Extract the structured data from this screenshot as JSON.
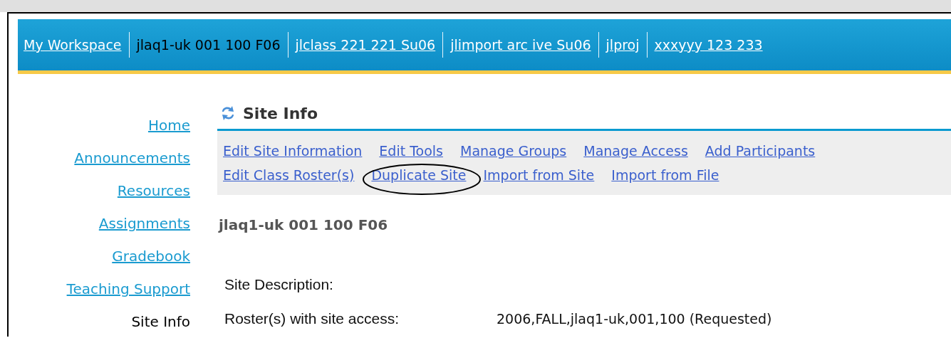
{
  "site_tabs": [
    {
      "label": "My Workspace",
      "selected": false
    },
    {
      "label": "jlaq1-uk 001 100 F06",
      "selected": true
    },
    {
      "label": "jlclass 221 221 Su06",
      "selected": false
    },
    {
      "label": "jlimport arc ive Su06",
      "selected": false
    },
    {
      "label": "jlproj",
      "selected": false
    },
    {
      "label": "xxxyyy 123 233",
      "selected": false
    }
  ],
  "sidebar": {
    "items": [
      {
        "label": "Home",
        "selected": false
      },
      {
        "label": "Announcements",
        "selected": false
      },
      {
        "label": "Resources",
        "selected": false
      },
      {
        "label": "Assignments",
        "selected": false
      },
      {
        "label": "Gradebook",
        "selected": false
      },
      {
        "label": "Teaching Support",
        "selected": false
      },
      {
        "label": "Site Info",
        "selected": true
      }
    ]
  },
  "tool": {
    "title": "Site Info",
    "actions": [
      [
        "Edit Site Information",
        "Edit Tools",
        "Manage Groups",
        "Manage Access",
        "Add Participants"
      ],
      [
        "Edit Class Roster(s)",
        "Duplicate Site",
        "Import from Site",
        "Import from File"
      ]
    ],
    "site_title": "jlaq1-uk 001 100 F06",
    "fields": [
      {
        "label": "Site Description:"
      },
      {
        "label": "Roster(s) with site access:",
        "value": "2006,FALL,jlaq1-uk,001,100 (Requested)"
      }
    ]
  }
}
